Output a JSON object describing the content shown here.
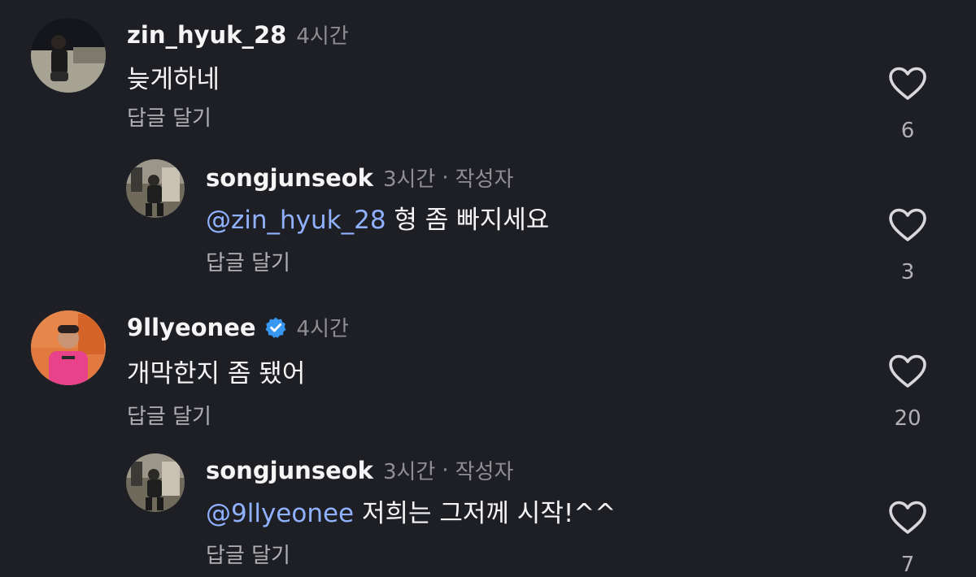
{
  "comments": [
    {
      "username": "zin_hyuk_28",
      "time": "4시간",
      "text": "늦게하네",
      "reply_label": "답글 달기",
      "likes": "6"
    },
    {
      "username": "songjunseok",
      "time": "3시간",
      "separator": "·",
      "author_tag": "작성자",
      "mention": "@zin_hyuk_28",
      "text": " 형 좀 빠지세요",
      "reply_label": "답글 달기",
      "likes": "3"
    },
    {
      "username": "9llyeonee",
      "verified": true,
      "time": "4시간",
      "text": "개막한지 좀 됐어",
      "reply_label": "답글 달기",
      "likes": "20"
    },
    {
      "username": "songjunseok",
      "time": "3시간",
      "separator": "·",
      "author_tag": "작성자",
      "mention": "@9llyeonee",
      "text": " 저희는 그저께 시작!^^",
      "reply_label": "답글 달기",
      "likes": "7"
    }
  ],
  "colors": {
    "background": "#1e1f24",
    "mention": "#8fb1ff",
    "verified": "#3897f0",
    "muted": "#8e8e93"
  },
  "icons": {
    "like": "heart-outline-icon",
    "verified": "verified-badge-icon"
  }
}
